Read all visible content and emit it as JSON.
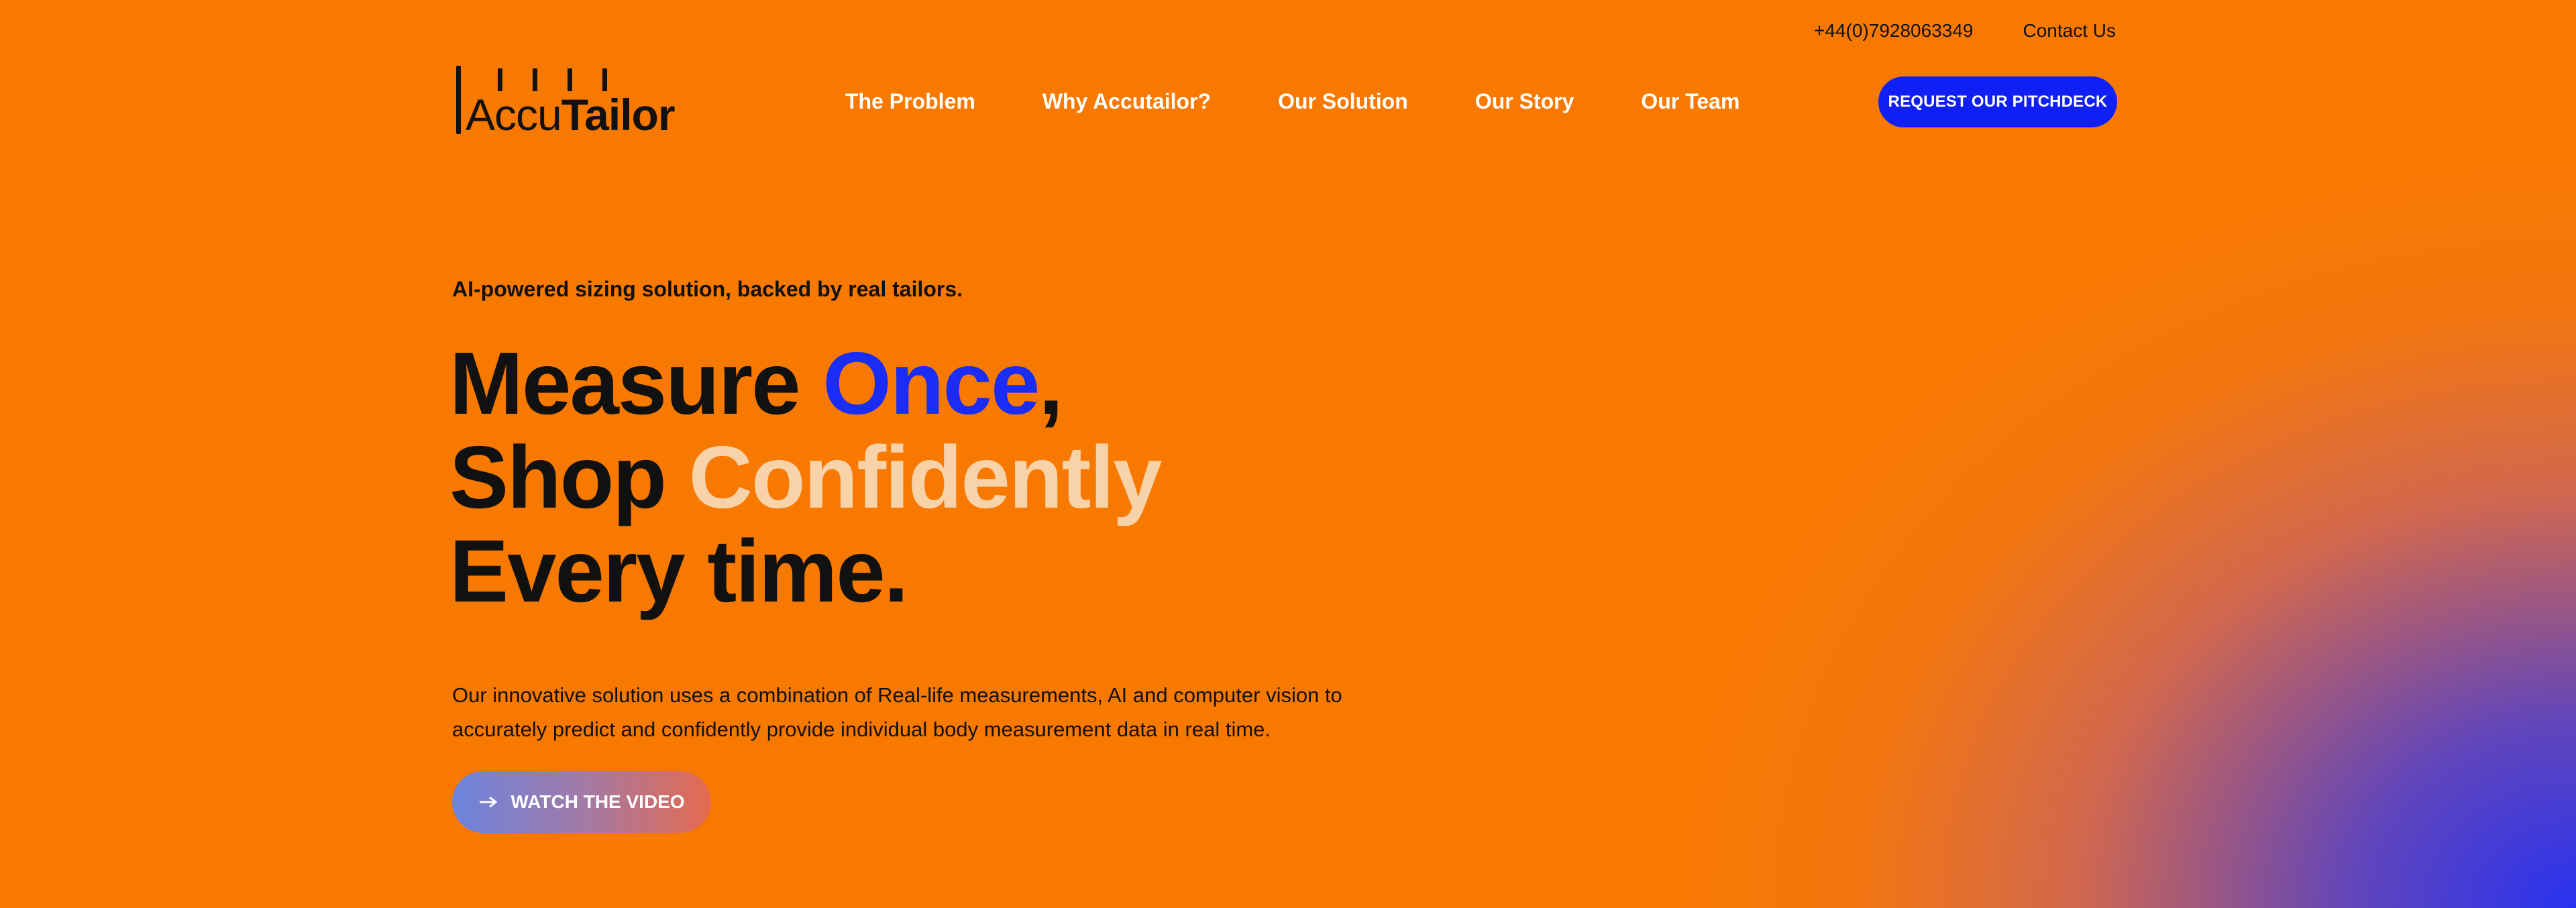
{
  "brand": {
    "name_part1": "Accu",
    "name_part2": "Tailor"
  },
  "topbar": {
    "phone": "+44(0)7928063349",
    "contact": "Contact Us"
  },
  "nav": {
    "items": [
      "The Problem",
      "Why Accutailor?",
      "Our Solution",
      "Our Story",
      "Our Team"
    ]
  },
  "cta": {
    "label": "REQUEST OUR PITCHDECK"
  },
  "hero": {
    "kicker": "AI-powered sizing solution, backed by real tailors.",
    "line1_a": "Measure ",
    "line1_b": "Once",
    "line1_c": ",",
    "line2_a": "Shop ",
    "line2_b": "Confidently",
    "line3": "Every time.",
    "body": "Our innovative solution uses a combination of Real-life measurements, AI and computer vision to accurately predict and confidently provide individual body measurement data in real time.",
    "video_button": "WATCH THE VIDEO",
    "video_icon": "arrow-right-icon"
  },
  "colors": {
    "background": "#f87900",
    "accent_blue": "#1a2cf5",
    "cream": "#f8d2a8"
  }
}
